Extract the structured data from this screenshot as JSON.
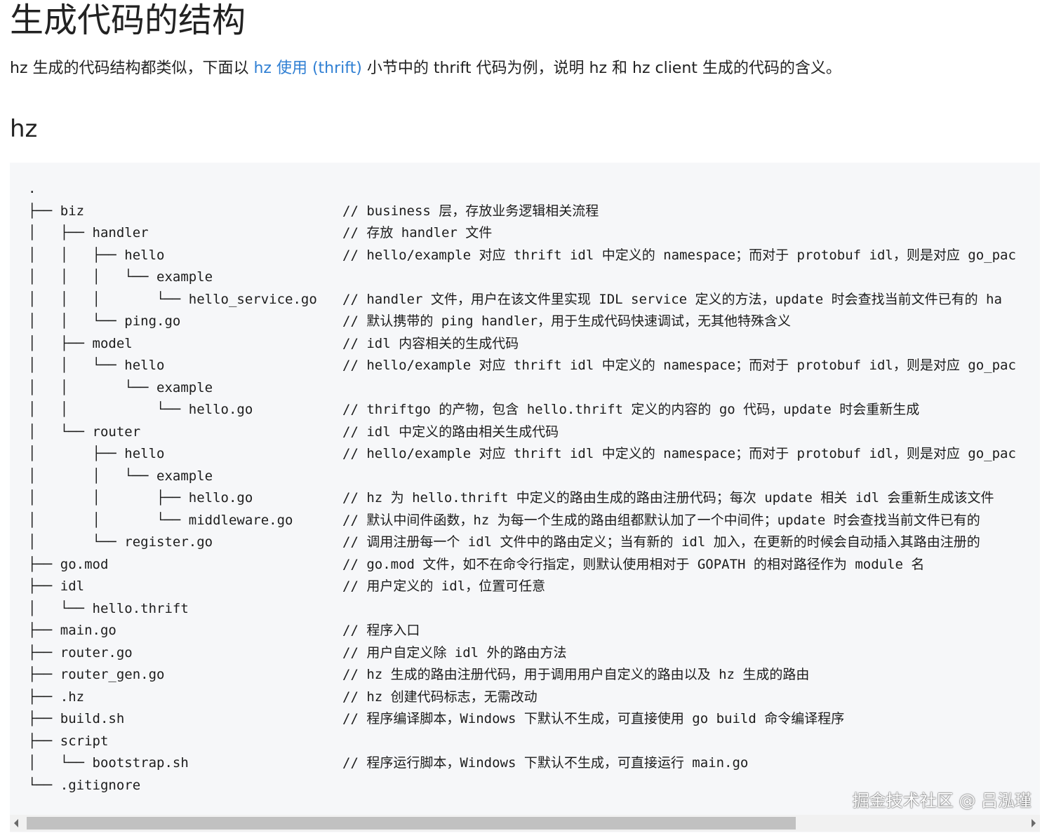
{
  "title": "生成代码的结构",
  "intro": {
    "before": "hz 生成的代码结构都类似，下面以 ",
    "link": "hz 使用 (thrift)",
    "after": " 小节中的 thrift 代码为例，说明 hz 和 hz client 生成的代码的含义。"
  },
  "section_heading": "hz",
  "tree": [
    {
      "text": ".",
      "comment": ""
    },
    {
      "text": "├── biz",
      "comment": "// business 层，存放业务逻辑相关流程"
    },
    {
      "text": "│   ├── handler",
      "comment": "// 存放 handler 文件"
    },
    {
      "text": "│   │   ├── hello",
      "comment": "// hello/example 对应 thrift idl 中定义的 namespace；而对于 protobuf idl，则是对应 go_pac"
    },
    {
      "text": "│   │   │   └── example",
      "comment": ""
    },
    {
      "text": "│   │   │       └── hello_service.go",
      "comment": "// handler 文件，用户在该文件里实现 IDL service 定义的方法，update 时会查找当前文件已有的 ha"
    },
    {
      "text": "│   │   └── ping.go",
      "comment": "// 默认携带的 ping handler，用于生成代码快速调试，无其他特殊含义"
    },
    {
      "text": "│   ├── model",
      "comment": "// idl 内容相关的生成代码"
    },
    {
      "text": "│   │   └── hello",
      "comment": "// hello/example 对应 thrift idl 中定义的 namespace；而对于 protobuf idl，则是对应 go_pac"
    },
    {
      "text": "│   │       └── example",
      "comment": ""
    },
    {
      "text": "│   │           └── hello.go",
      "comment": "// thriftgo 的产物，包含 hello.thrift 定义的内容的 go 代码，update 时会重新生成"
    },
    {
      "text": "│   └── router",
      "comment": "// idl 中定义的路由相关生成代码"
    },
    {
      "text": "│       ├── hello",
      "comment": "// hello/example 对应 thrift idl 中定义的 namespace；而对于 protobuf idl，则是对应 go_pac"
    },
    {
      "text": "│       │   └── example",
      "comment": ""
    },
    {
      "text": "│       │       ├── hello.go",
      "comment": "// hz 为 hello.thrift 中定义的路由生成的路由注册代码；每次 update 相关 idl 会重新生成该文件"
    },
    {
      "text": "│       │       └── middleware.go",
      "comment": "// 默认中间件函数，hz 为每一个生成的路由组都默认加了一个中间件；update 时会查找当前文件已有的"
    },
    {
      "text": "│       └── register.go",
      "comment": "// 调用注册每一个 idl 文件中的路由定义；当有新的 idl 加入，在更新的时候会自动插入其路由注册的"
    },
    {
      "text": "├── go.mod",
      "comment": "// go.mod 文件，如不在命令行指定，则默认使用相对于 GOPATH 的相对路径作为 module 名"
    },
    {
      "text": "├── idl",
      "comment": "// 用户定义的 idl，位置可任意"
    },
    {
      "text": "│   └── hello.thrift",
      "comment": ""
    },
    {
      "text": "├── main.go",
      "comment": "// 程序入口"
    },
    {
      "text": "├── router.go",
      "comment": "// 用户自定义除 idl 外的路由方法"
    },
    {
      "text": "├── router_gen.go",
      "comment": "// hz 生成的路由注册代码，用于调用用户自定义的路由以及 hz 生成的路由"
    },
    {
      "text": "├── .hz",
      "comment": "// hz 创建代码标志，无需改动"
    },
    {
      "text": "├── build.sh",
      "comment": "// 程序编译脚本，Windows 下默认不生成，可直接使用 go build 命令编译程序"
    },
    {
      "text": "├── script",
      "comment": ""
    },
    {
      "text": "│   └── bootstrap.sh",
      "comment": "// 程序运行脚本，Windows 下默认不生成，可直接运行 main.go"
    },
    {
      "text": "└── .gitignore",
      "comment": ""
    }
  ],
  "watermark": "掘金技术社区 @ 吕泓瑾",
  "colors": {
    "link": "#2f7fd3",
    "code_background": "#f6f7f9",
    "scrollbar_track": "#f1f1f1",
    "scrollbar_thumb": "#c1c1c1"
  }
}
